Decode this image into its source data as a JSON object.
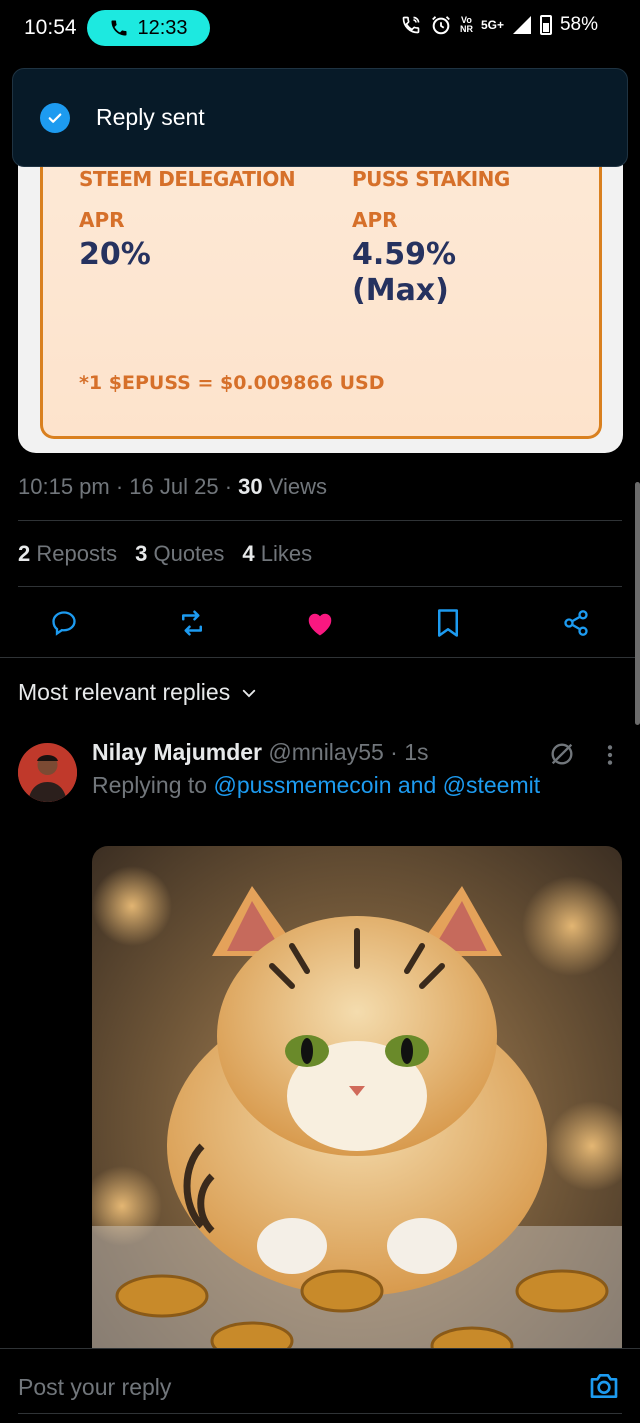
{
  "status_bar": {
    "time": "10:54",
    "call_time": "12:33",
    "network_top": "Vo",
    "network_bottom": "NR",
    "network_gen": "5G+",
    "battery": "58%"
  },
  "toast": {
    "text": "Reply sent"
  },
  "promo_card": {
    "left_heading": "STEEM DELEGATION",
    "right_heading": "PUSS STAKING",
    "left_apr_label": "APR",
    "right_apr_label": "APR",
    "left_value": "20%",
    "right_value_line1": "4.59%",
    "right_value_line2": "(Max)",
    "footnote": "*1 $EPUSS = $0.009866 USD"
  },
  "post_meta": {
    "time": "10:15 pm",
    "date": "16 Jul 25",
    "views_count": "30",
    "views_label": "Views"
  },
  "stats": {
    "reposts_count": "2",
    "reposts_label": "Reposts",
    "quotes_count": "3",
    "quotes_label": "Quotes",
    "likes_count": "4",
    "likes_label": "Likes"
  },
  "colors": {
    "accent": "#1d9bf0",
    "like": "#f91880",
    "call_pill": "#1de9e0"
  },
  "replies_filter": {
    "label": "Most relevant replies"
  },
  "reply": {
    "name": "Nilay Majumder",
    "handle": "@mnilay55",
    "time": "1s",
    "replying_prefix": "Replying to",
    "replying_to": "@pussmemecoin and @steemit"
  },
  "composer": {
    "placeholder": "Post your reply"
  }
}
